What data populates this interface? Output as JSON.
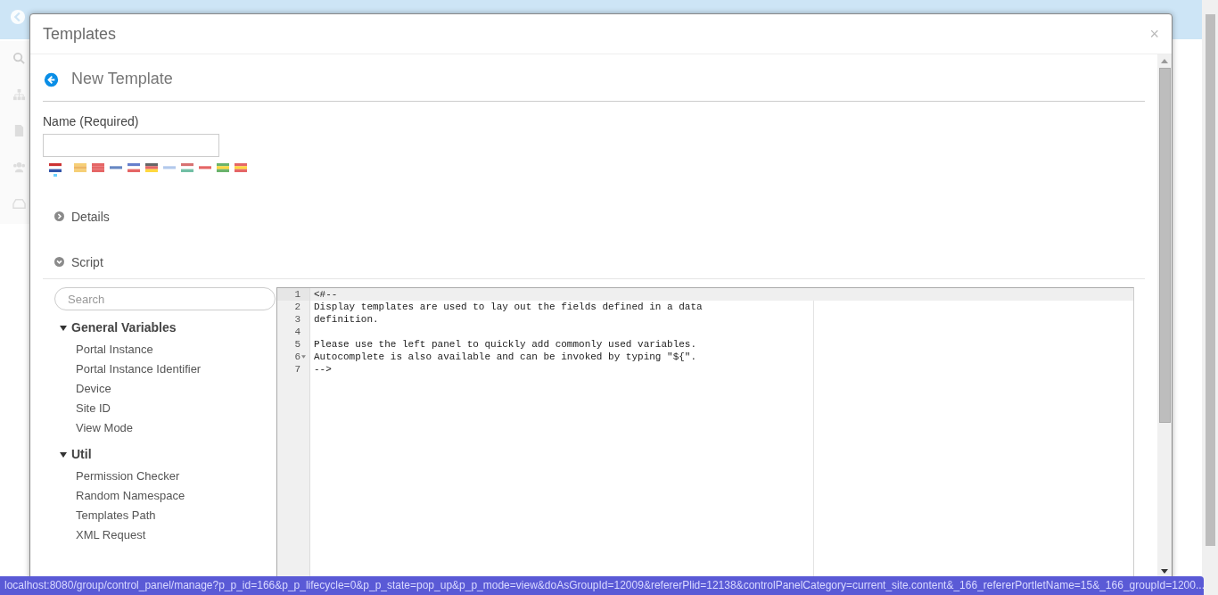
{
  "dialog": {
    "title": "Templates",
    "close": "×"
  },
  "form": {
    "heading": "New Template",
    "name_label": "Name (Required)",
    "languages": [
      {
        "selected": true
      },
      {
        "selected": false
      },
      {
        "selected": false
      },
      {
        "selected": false
      },
      {
        "selected": false
      },
      {
        "selected": false
      },
      {
        "selected": false
      },
      {
        "selected": false
      },
      {
        "selected": false
      },
      {
        "selected": false
      },
      {
        "selected": false
      }
    ]
  },
  "sections": [
    {
      "label": "Details",
      "expanded": false
    },
    {
      "label": "Script",
      "expanded": true
    }
  ],
  "variables": {
    "search_placeholder": "Search",
    "groups": [
      {
        "label": "General Variables",
        "expanded": true,
        "children": [
          {
            "label": "Portal Instance"
          },
          {
            "label": "Portal Instance Identifier"
          },
          {
            "label": "Device"
          },
          {
            "label": "Site ID"
          },
          {
            "label": "View Mode"
          }
        ]
      },
      {
        "label": "Util",
        "expanded": true,
        "children": [
          {
            "label": "Permission Checker"
          },
          {
            "label": "Random Namespace"
          },
          {
            "label": "Templates Path"
          },
          {
            "label": "XML Request"
          }
        ]
      }
    ]
  },
  "editor": {
    "lines": [
      {
        "number": "1",
        "text": "<#--",
        "current": true,
        "foldable": false
      },
      {
        "number": "2",
        "text": "Display templates are used to lay out the fields defined in a data",
        "current": false,
        "foldable": false
      },
      {
        "number": "3",
        "text": "definition.",
        "current": false,
        "foldable": false
      },
      {
        "number": "4",
        "current": false,
        "foldable": false
      },
      {
        "number": "5",
        "text": "Please use the left panel to quickly add commonly used variables.",
        "current": false,
        "foldable": false
      },
      {
        "number": "6",
        "text": "Autocomplete is also available and can be invoked by typing \"${\".",
        "current": false,
        "foldable": true
      },
      {
        "number": "7",
        "text": "-->",
        "current": false,
        "foldable": false
      }
    ]
  },
  "status_bar": {
    "url": "localhost:8080/group/control_panel/manage?p_p_id=166&p_p_lifecycle=0&p_p_state=pop_up&p_p_mode=view&doAsGroupId=12009&refererPlid=12138&controlPanelCategory=current_site.content&_166_refererPortletName=15&_166_groupId=1200..."
  }
}
